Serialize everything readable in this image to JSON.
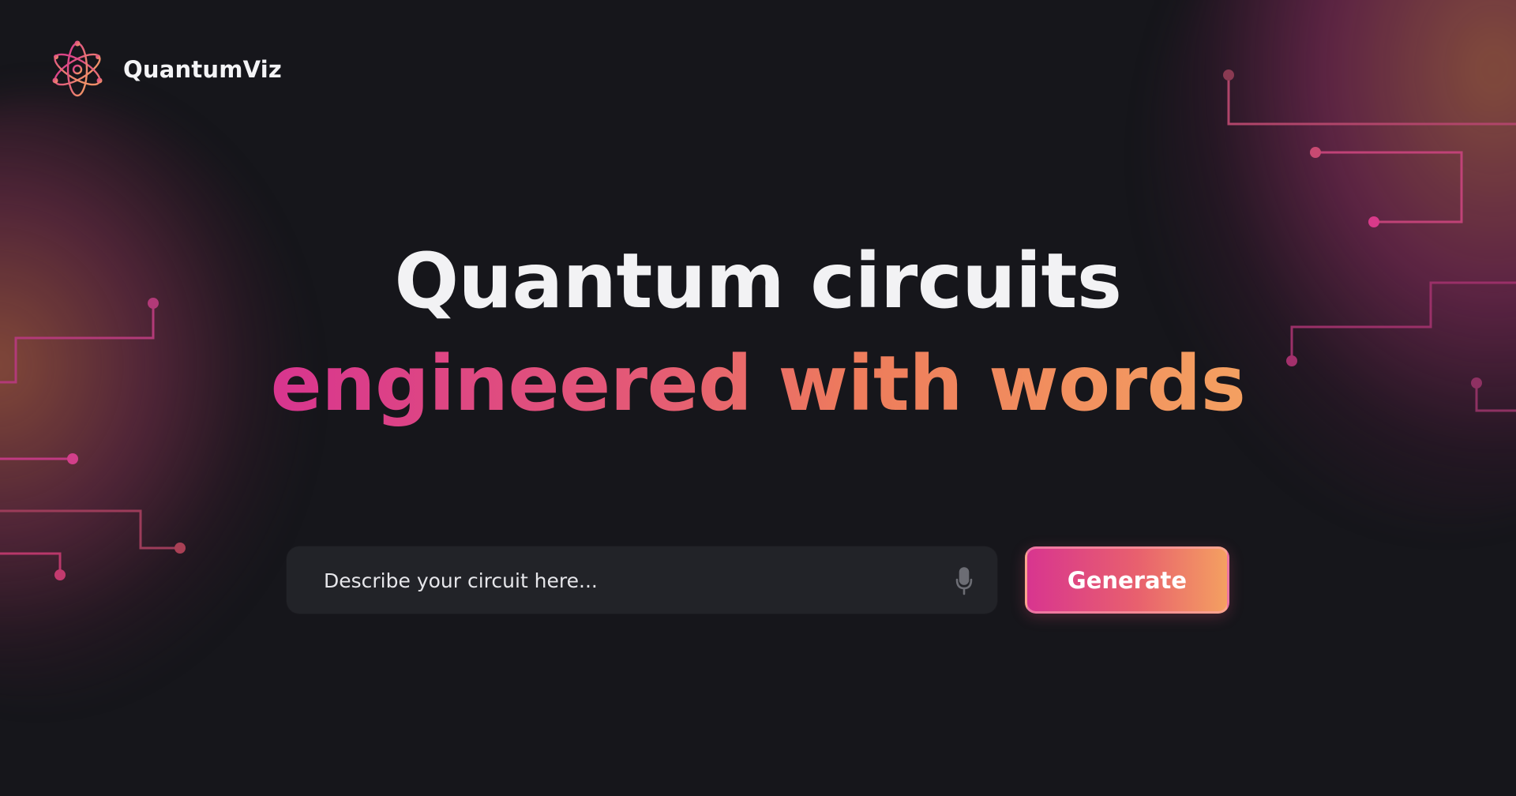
{
  "brand": {
    "name": "QuantumViz",
    "logo_icon": "atom-icon"
  },
  "hero": {
    "line1": "Quantum circuits",
    "line2": "engineered with words"
  },
  "prompt": {
    "placeholder": "Describe your circuit here...",
    "value": "",
    "mic_icon": "microphone-icon"
  },
  "actions": {
    "generate_label": "Generate"
  },
  "colors": {
    "background": "#16161b",
    "gradient_start": "#d8358f",
    "gradient_end": "#f4a061",
    "input_background": "#222328",
    "text_primary": "#f2f2f4"
  }
}
